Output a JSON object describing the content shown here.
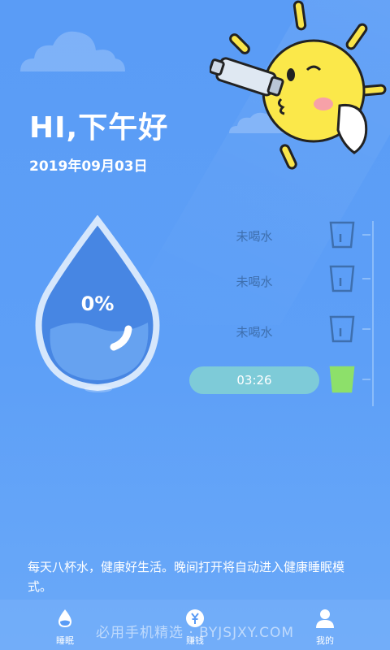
{
  "header": {
    "greeting": "HI,下午好",
    "date": "2019年09月03日"
  },
  "drop": {
    "percent_text": "0%",
    "fill_fraction": 0.0
  },
  "cups": [
    {
      "label": "未喝水",
      "filled": false
    },
    {
      "label": "未喝水",
      "filled": false
    },
    {
      "label": "未喝水",
      "filled": false
    },
    {
      "label": "03:26",
      "filled": true,
      "is_timer": true
    }
  ],
  "tip": "每天八杯水，健康好生活。晚间打开将自动进入健康睡眠模式。",
  "tabbar": {
    "items": [
      {
        "label": "睡眠",
        "icon": "water-drop-icon"
      },
      {
        "label": "赚钱",
        "icon": "yen-coin-icon"
      },
      {
        "label": "我的",
        "icon": "person-icon"
      }
    ]
  },
  "watermark": "必用手机精选 · BYJSJXY.COM",
  "colors": {
    "background": "#5a9cf6",
    "cup_filled": "#8de06a",
    "timer_pill": "#7ecbd8",
    "cup_empty_stroke": "#3e6fae"
  }
}
